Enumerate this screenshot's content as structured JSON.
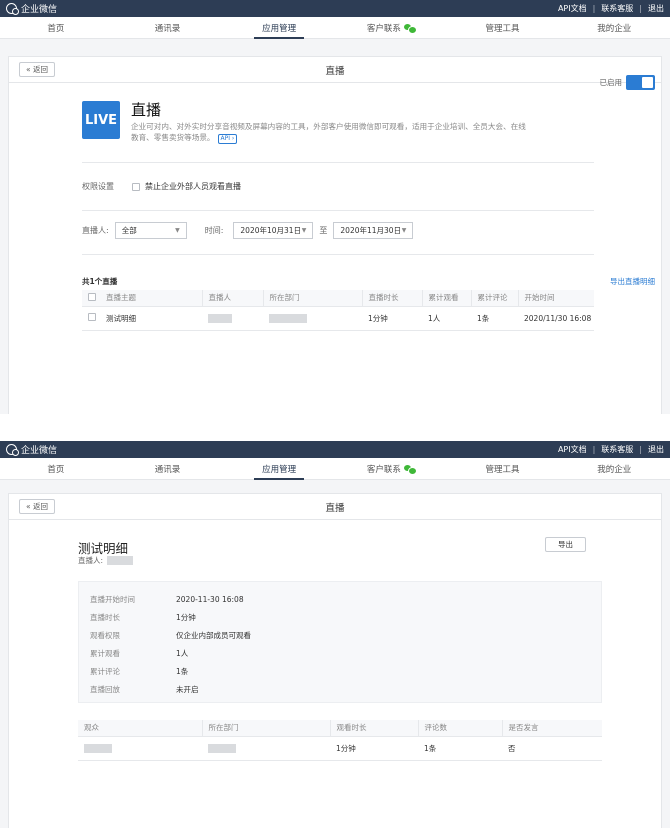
{
  "topbar": {
    "brand": "企业微信",
    "links": [
      "API文档",
      "联系客服",
      "退出"
    ]
  },
  "nav": {
    "items": [
      "首页",
      "通讯录",
      "应用管理",
      "客户联系",
      "管理工具",
      "我的企业"
    ],
    "active": 2
  },
  "screen1": {
    "back_label": "« 返回",
    "page_title": "直播",
    "app": {
      "logo_text": "LIVE",
      "name": "直播",
      "description": "企业可对内、对外实时分享音视频及屏幕内容的工具，外部客户使用微信即可观看，适用于企业培训、全员大会、在线教育、零售卖货等场景。",
      "api_tag": "API ›",
      "status_label": "已启用",
      "enabled": true
    },
    "permission": {
      "label": "权限设置",
      "option": "禁止企业外部人员观看直播",
      "checked": false
    },
    "filter": {
      "host_label": "直播人:",
      "host_value": "全部",
      "time_label": "时间:",
      "start_date": "2020年10月31日",
      "separator": "至",
      "end_date": "2020年11月30日"
    },
    "count_label": "共1个直播",
    "export_link": "导出直播明细",
    "table": {
      "headers": [
        "直播主题",
        "直播人",
        "所在部门",
        "直播时长",
        "累计观看",
        "累计评论",
        "开始时间"
      ],
      "rows": [
        {
          "topic": "测试明细",
          "duration": "1分钟",
          "views": "1人",
          "comments": "1条",
          "start": "2020/11/30 16:08"
        }
      ]
    }
  },
  "screen2": {
    "back_label": "« 返回",
    "page_title": "直播",
    "detail_title": "测试明细",
    "host_label": "直播人:",
    "export_button": "导出",
    "info": [
      {
        "key": "直播开始时间",
        "value": "2020-11-30 16:08"
      },
      {
        "key": "直播时长",
        "value": "1分钟"
      },
      {
        "key": "观看权限",
        "value": "仅企业内部成员可观看"
      },
      {
        "key": "累计观看",
        "value": "1人"
      },
      {
        "key": "累计评论",
        "value": "1条"
      },
      {
        "key": "直播回放",
        "value": "未开启"
      }
    ],
    "viewers": {
      "headers": [
        "观众",
        "所在部门",
        "观看时长",
        "评论数",
        "是否发言"
      ],
      "rows": [
        {
          "duration": "1分钟",
          "comments": "1条",
          "spoke": "否"
        }
      ]
    }
  }
}
